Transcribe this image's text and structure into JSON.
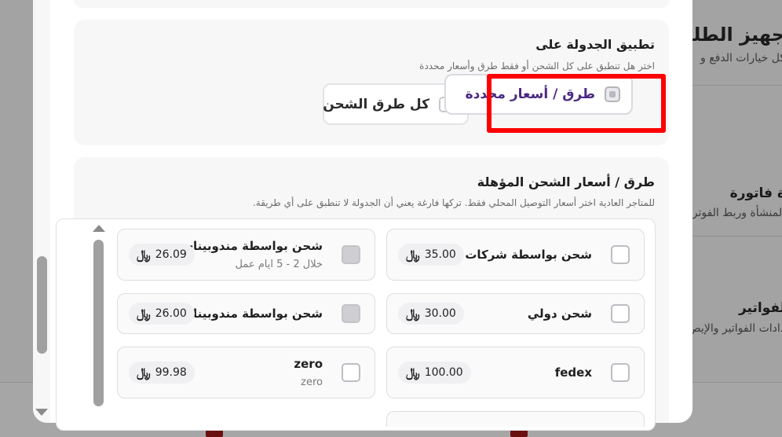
{
  "background": {
    "title": "جهيز الطلبات",
    "subtitle": "كل خيارات الدفع و",
    "heading2": "ة فاتورة",
    "sub2": "المنشأة وربط الفوتر",
    "heading3": "لفواتير",
    "sub3": "دادات الفواتير والإيص"
  },
  "apply_section": {
    "title": "تطبيق الجدولة على",
    "description": "اختر هل تنطبق على كل الشحن أو فقط طرق وأسعار محددة",
    "options": [
      {
        "label": "طرق / أسعار محددة",
        "selected": true
      },
      {
        "label": "كل طرق الشحن",
        "selected": false
      }
    ]
  },
  "methods_section": {
    "title": "طرق / أسعار الشحن المؤهلة",
    "description": "للمتاجر العادية اختر أسعار التوصيل المحلي فقط. تركها فارغة يعني أن الجدولة لا تنطبق على أي طريقة.",
    "items": [
      {
        "name": "شحن بواسطة شركات ال...",
        "price": "35.00",
        "subtitle": ""
      },
      {
        "name": "شحن بواسطة مندوبينا-...",
        "price": "26.09",
        "subtitle": "خلال 2 - 5 ايام عمل"
      },
      {
        "name": "شحن دولي",
        "price": "30.00",
        "subtitle": ""
      },
      {
        "name": "شحن بواسطة مندوبينا ...",
        "price": "26.00",
        "subtitle": ""
      },
      {
        "name": "fedex",
        "price": "100.00",
        "subtitle": ""
      },
      {
        "name": "zero",
        "price": "99.98",
        "subtitle": "zero"
      }
    ]
  },
  "currency_icon": "riyal-sign-icon",
  "currency_glyph": "﷼",
  "colors": {
    "accent_text": "#4b2a82",
    "highlight": "#ff0000"
  }
}
